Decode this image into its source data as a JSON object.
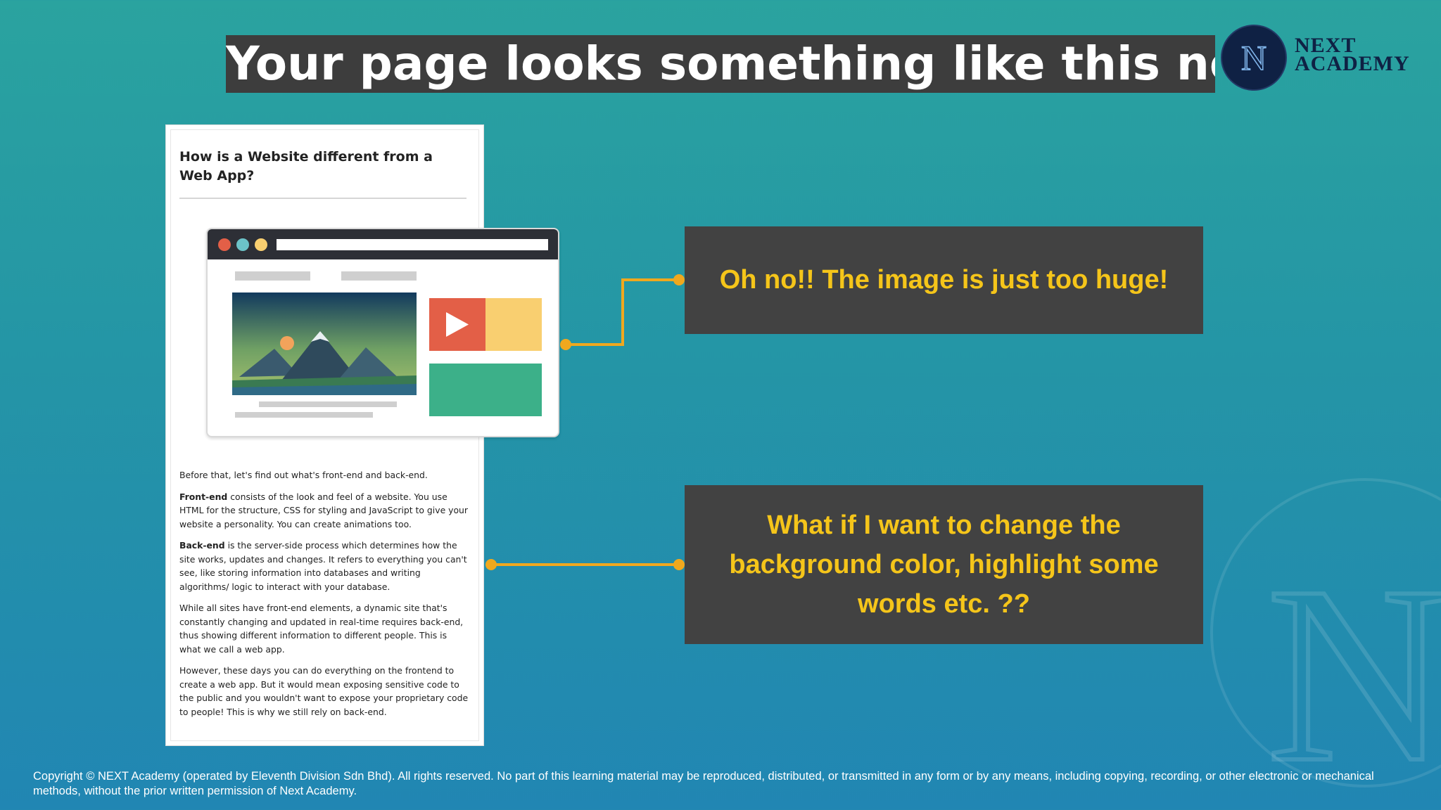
{
  "slide": {
    "title": "Your page looks something like this now?",
    "brand": {
      "monogram": "N",
      "name_line1": "NEXT",
      "name_line2": "ACADEMY",
      "color": "#0f2144"
    }
  },
  "document": {
    "heading": "How is a Website different from a Web App?",
    "intro": "Before that, let's find out what's front-end and back-end.",
    "frontend_term": "Front-end",
    "frontend_text": " consists of the look and feel of a website. You use HTML for the structure, CSS for styling and JavaScript to give your website a personality. You can create animations too.",
    "backend_term": "Back-end",
    "backend_text": " is the server-side process which determines how the site works, updates and changes. It refers to everything you can't see, like storing information into databases and writing algorithms/ logic to interact with your database.",
    "paragraph_dynamic": "While all sites have front-end elements, a dynamic site that's constantly changing and updated in real-time requires back-end, thus showing different information to different people. This is what we call a web app.",
    "paragraph_frontend": "However, these days you can do everything on the frontend to create a web app. But it would mean exposing sensitive code to the public and you wouldn't want to expose your proprietary code to people! This is why we still rely on back-end."
  },
  "illustration": {
    "dot_colors": [
      "#e35f47",
      "#6cc3c9",
      "#f9cf70"
    ],
    "play_color": "#e35f47",
    "tile_yellow": "#f9cf70",
    "tile_green": "#3cb089"
  },
  "callouts": {
    "first": "Oh no!! The image is just too huge!",
    "second": "What if I want to change the background color, highlight some words etc. ??",
    "text_color": "#f5c51a",
    "box_color": "#424242",
    "connector_color": "#f0a81e"
  },
  "footer": {
    "copyright": "Copyright © NEXT Academy (operated by Eleventh Division Sdn Bhd). All rights reserved. No part of this learning material may be reproduced, distributed, or transmitted in any form or by any means, including copying, recording, or other electronic or mechanical methods, without the prior written permission of Next Academy."
  }
}
